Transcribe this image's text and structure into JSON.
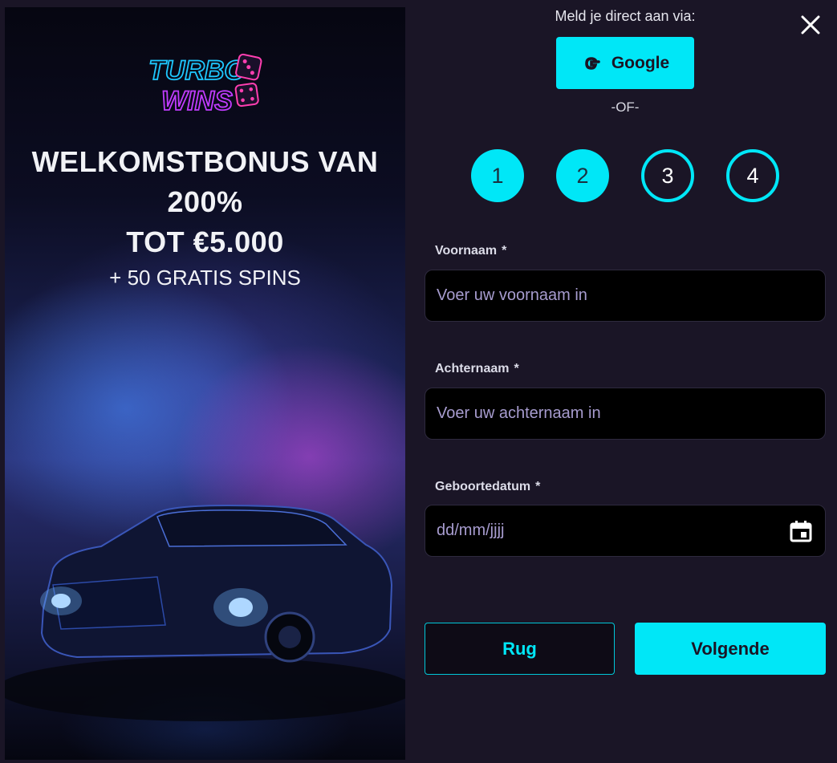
{
  "promo": {
    "logo_line1": "TURBO",
    "logo_line2": "WINS",
    "headline_1": "WELKOMSTBONUS VAN",
    "headline_2": "200%",
    "headline_3": "TOT €5.000",
    "subline": "+ 50 GRATIS SPINS"
  },
  "signup": {
    "via_label": "Meld je direct aan via:",
    "google_label": "Google",
    "or_label": "-OF-"
  },
  "steps": [
    {
      "number": "1",
      "state": "completed"
    },
    {
      "number": "2",
      "state": "current"
    },
    {
      "number": "3",
      "state": "pending"
    },
    {
      "number": "4",
      "state": "pending"
    }
  ],
  "form": {
    "required_mark": "*",
    "first_name": {
      "label": "Voornaam",
      "placeholder": "Voer uw voornaam in",
      "value": ""
    },
    "last_name": {
      "label": "Achternaam",
      "placeholder": "Voer uw achternaam in",
      "value": ""
    },
    "birthdate": {
      "label": "Geboortedatum",
      "placeholder": "dd/mm/jjjj",
      "value": ""
    }
  },
  "actions": {
    "back_label": "Rug",
    "next_label": "Volgende"
  },
  "colors": {
    "accent": "#00e7f7",
    "background": "#1a1526",
    "input_bg": "#000000",
    "placeholder": "#a79ccf"
  },
  "icons": {
    "close": "close-icon",
    "google": "google-icon",
    "calendar": "calendar-icon"
  }
}
